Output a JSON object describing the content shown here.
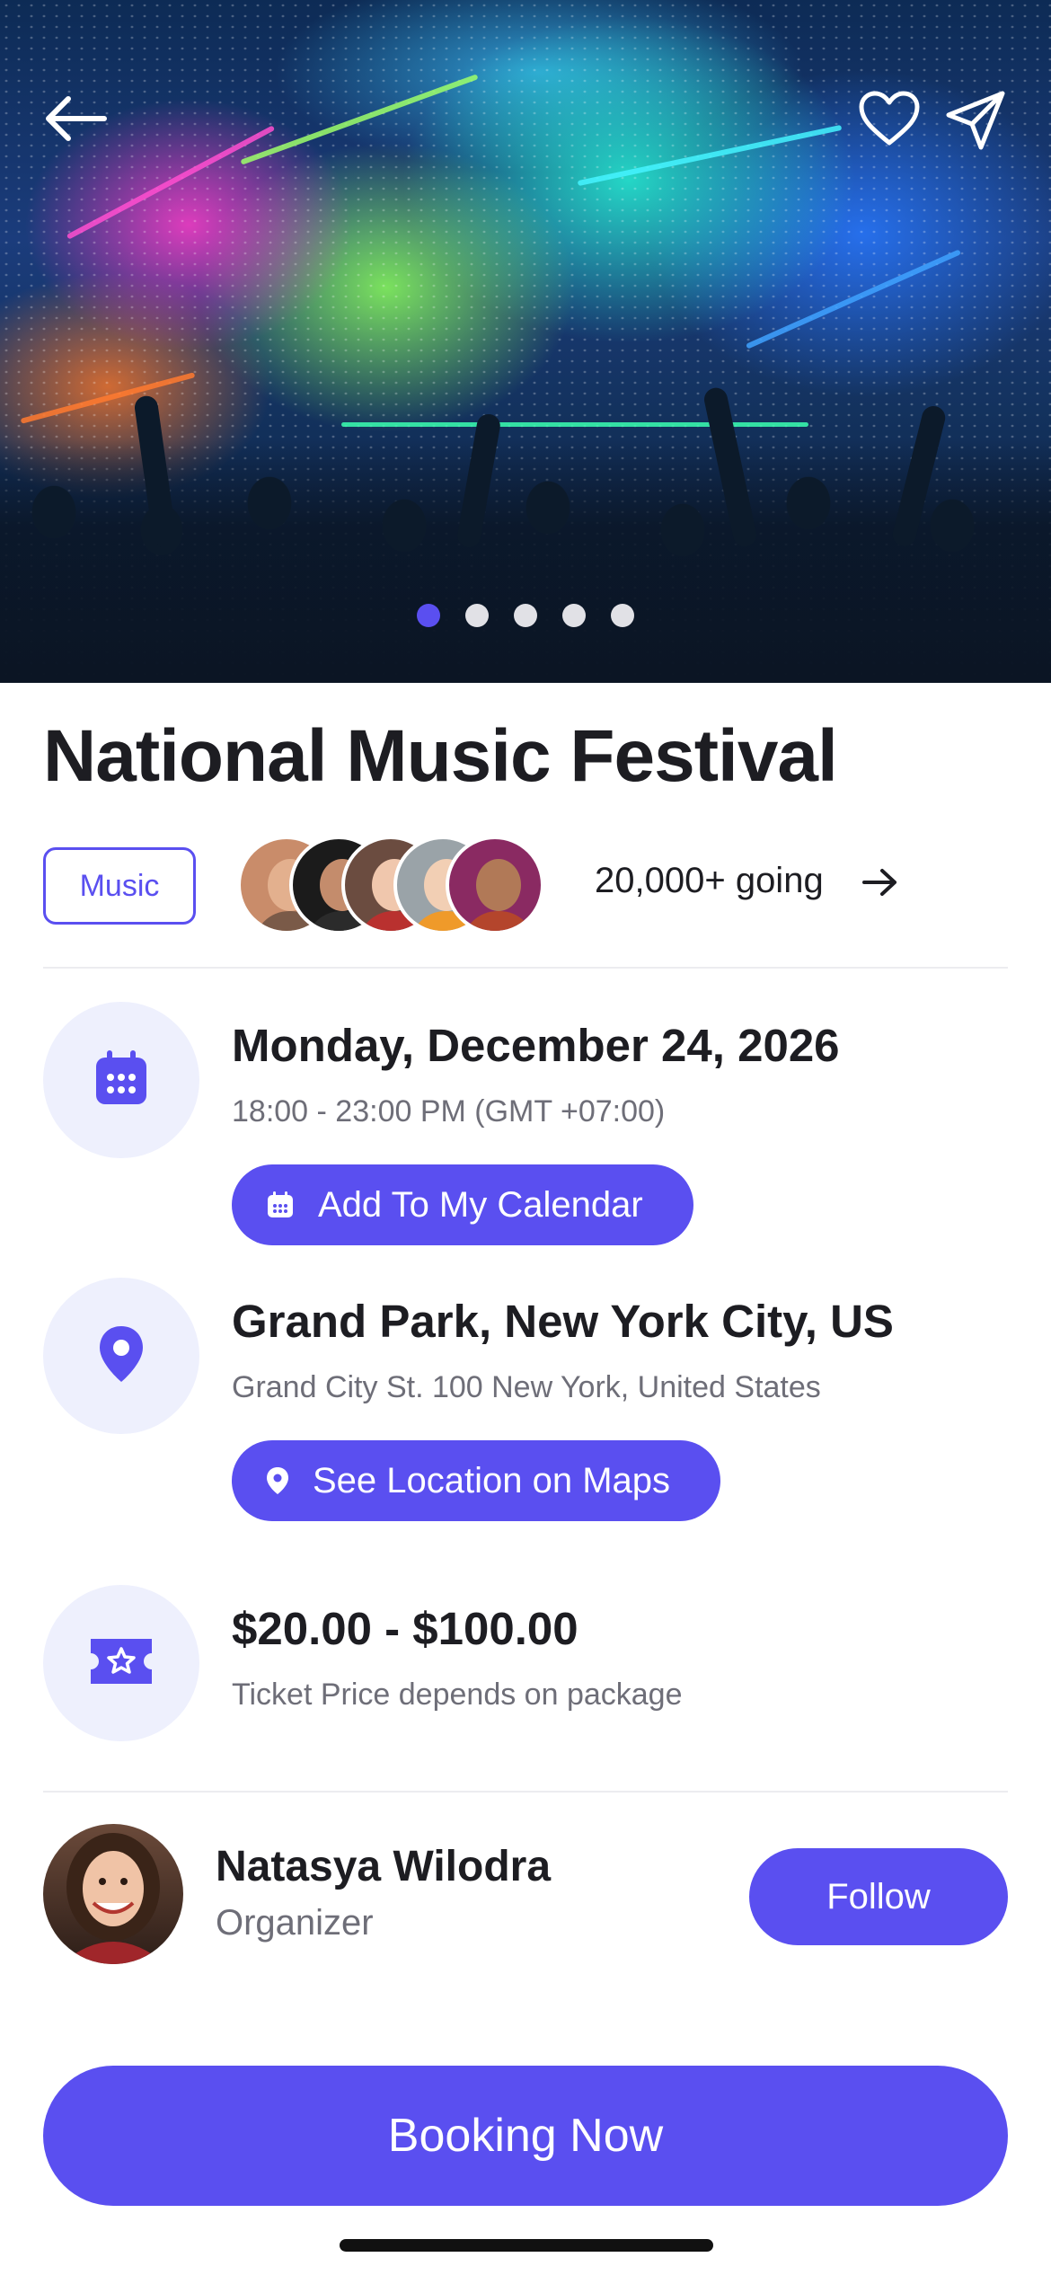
{
  "hero": {
    "image_alt": "Concert stage with colorful lights and crowd",
    "carousel_total": 5,
    "carousel_active_index": 0
  },
  "icons": {
    "back": "back-arrow-icon",
    "favorite": "heart-icon",
    "share": "send-icon",
    "calendar": "calendar-icon",
    "location": "map-pin-icon",
    "ticket": "ticket-icon",
    "going_arrow": "arrow-right-icon"
  },
  "event": {
    "title": "National Music Festival",
    "category": "Music",
    "attendees_text": "20,000+ going"
  },
  "date": {
    "title": "Monday, December 24, 2026",
    "time": "18:00 - 23:00 PM (GMT +07:00)",
    "button_label": "Add To My Calendar"
  },
  "location": {
    "title": "Grand Park, New York City, US",
    "address": "Grand City St. 100 New York, United States",
    "button_label": "See Location on Maps"
  },
  "price": {
    "title": "$20.00 - $100.00",
    "note": "Ticket Price depends on package"
  },
  "organizer": {
    "name": "Natasya Wilodra",
    "role": "Organizer",
    "follow_label": "Follow"
  },
  "cta": {
    "booking_label": "Booking Now"
  },
  "colors": {
    "accent": "#5a4ff0",
    "icon_bg": "#eef0fd",
    "text_primary": "#1d1d22",
    "text_secondary": "#6e6e78"
  }
}
